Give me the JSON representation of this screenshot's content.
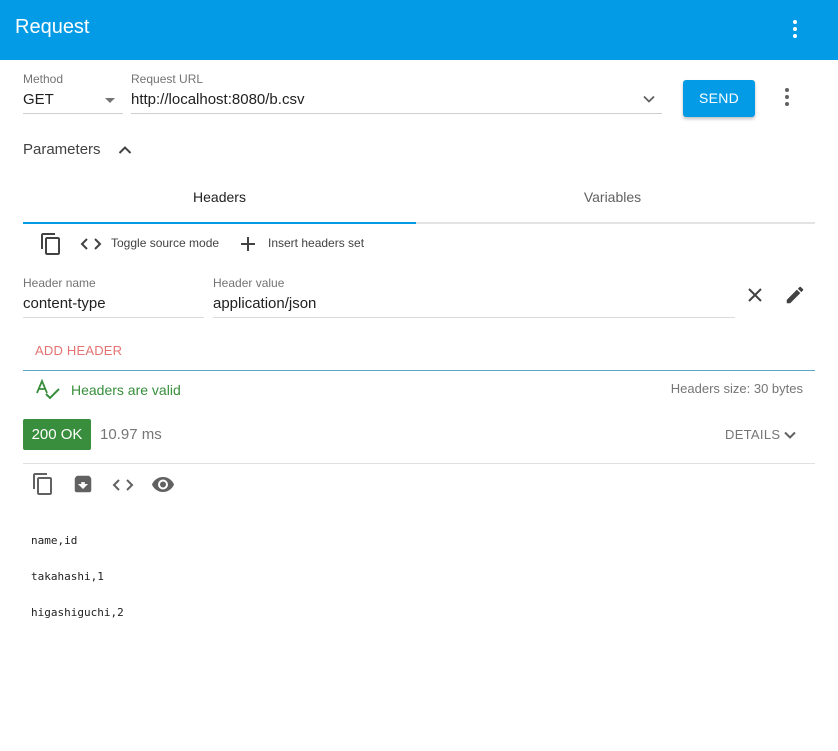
{
  "appbar": {
    "title": "Request",
    "menu_icon": "more-vert-icon"
  },
  "request": {
    "method_label": "Method",
    "method_value": "GET",
    "url_label": "Request URL",
    "url_value": "http://localhost:8080/b.csv",
    "send_label": "SEND"
  },
  "parameters": {
    "label": "Parameters"
  },
  "tabs": [
    {
      "label": "Headers",
      "active": true
    },
    {
      "label": "Variables",
      "active": false
    }
  ],
  "headers_toolbar": {
    "copy_icon": "copy-icon",
    "toggle_source_label": "Toggle source mode",
    "insert_set_label": "Insert headers set"
  },
  "header_row": {
    "name_label": "Header name",
    "name_value": "content-type",
    "value_label": "Header value",
    "value_value": "application/json"
  },
  "add_header_label": "ADD HEADER",
  "validation": {
    "text": "Headers are valid",
    "size_text": "Headers size: 30 bytes"
  },
  "response": {
    "status": "200 OK",
    "time": "10.97 ms",
    "details_label": "DETAILS",
    "body_lines": [
      "name,id",
      "takahashi,1",
      "higashiguchi,2"
    ]
  },
  "colors": {
    "accent": "#039be5",
    "success": "#388e3c",
    "add_header": "#e57373"
  }
}
